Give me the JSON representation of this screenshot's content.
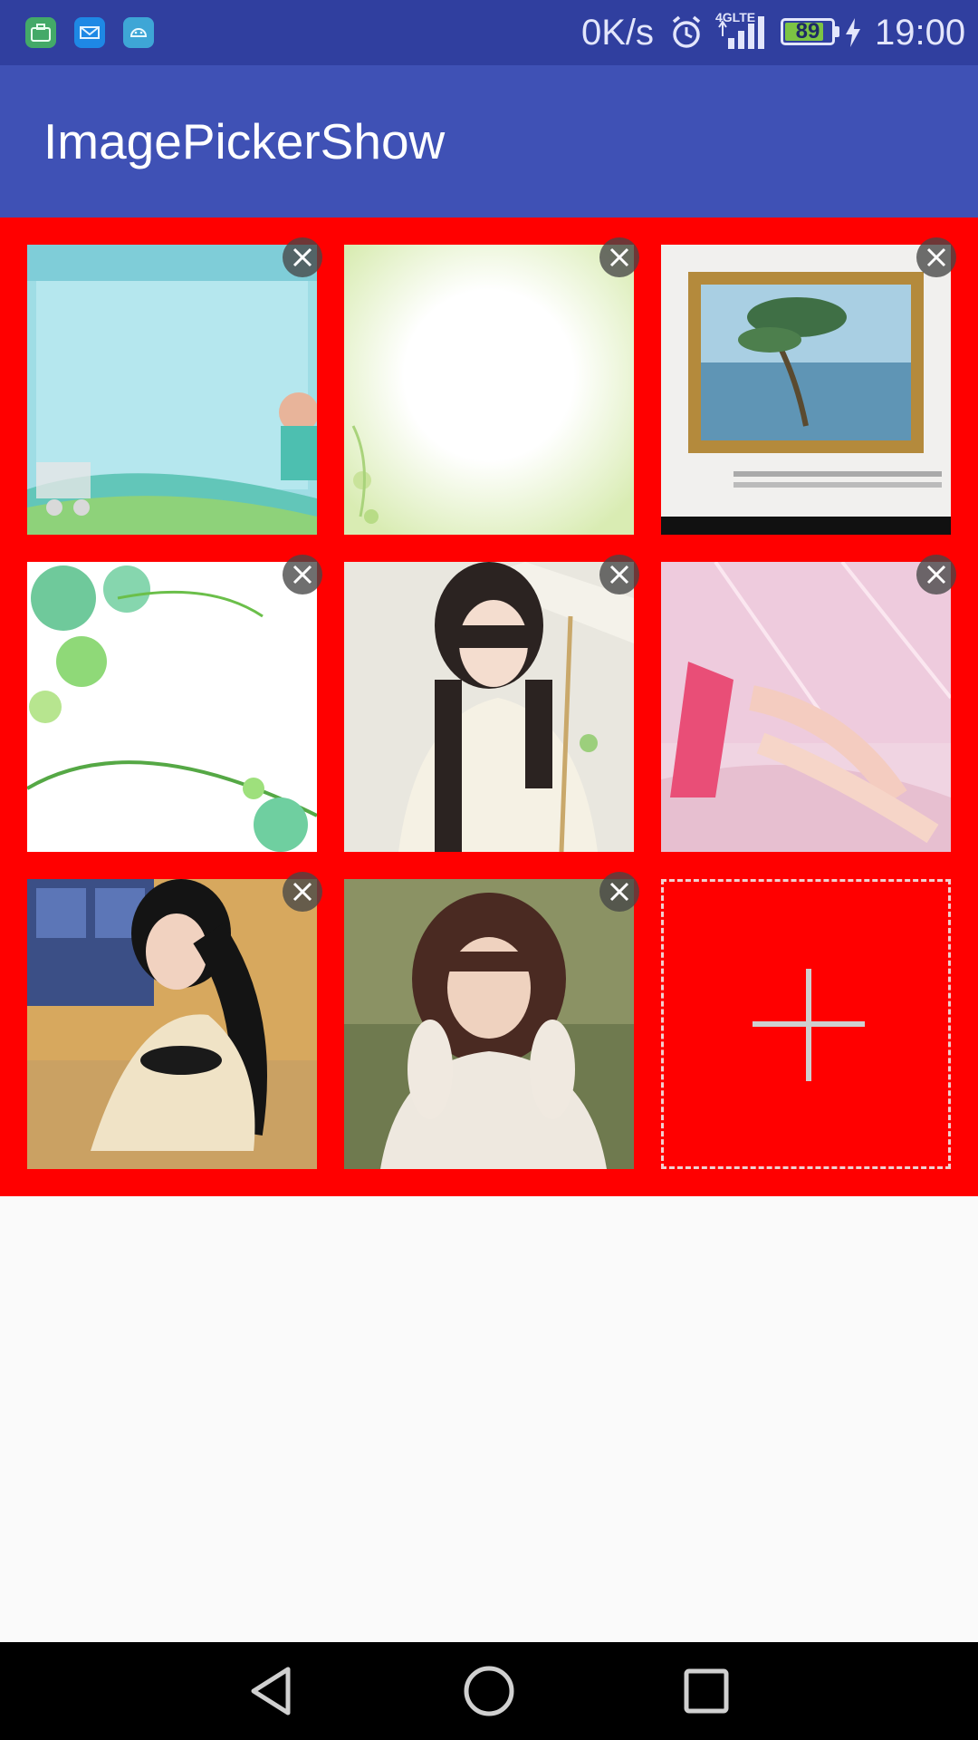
{
  "status_bar": {
    "net_speed": "0K/s",
    "network_type": "4G LTE",
    "battery_level": "89",
    "time": "19:00",
    "notification_icons": [
      "briefcase-icon",
      "mail-app-icon",
      "android-icon"
    ]
  },
  "app_bar": {
    "title": "ImagePickerShow",
    "color": "#3f51b5",
    "status_color": "#303f9f"
  },
  "grid": {
    "background_color": "#ff0000",
    "images": [
      {
        "subject": "teal decorative frame with cartoon girl and cart"
      },
      {
        "subject": "pale green vignette with flowers"
      },
      {
        "subject": "framed painting of tree by the sea"
      },
      {
        "subject": "green floral swirl border"
      },
      {
        "subject": "girl with paper umbrella"
      },
      {
        "subject": "girl on pink tiled background"
      },
      {
        "subject": "girl with long black hair in wooden room"
      },
      {
        "subject": "girl with hands to her hair"
      }
    ],
    "delete_icon": "close-icon",
    "add_icon": "plus-icon"
  },
  "nav_bar": {
    "buttons": [
      "back-icon",
      "home-icon",
      "recents-icon"
    ]
  }
}
